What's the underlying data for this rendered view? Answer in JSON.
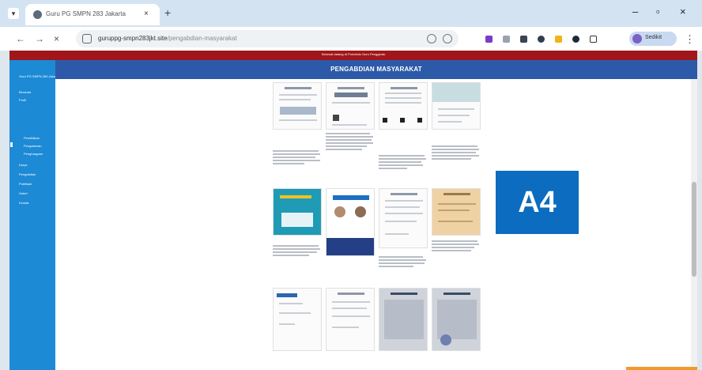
{
  "browser": {
    "tab_title": "Guru PG SMPN 283 Jakarta",
    "tab_menu_icon": "chevron-down-icon",
    "new_tab_label": "+",
    "url_host": "guruppg-smpn283jkt.site",
    "url_path": "/pengabdian-masyarakat",
    "profile_label": "Sedikit",
    "window_controls": [
      "–",
      "▫",
      "×"
    ]
  },
  "page": {
    "top_notice": "Selamat datang di Portofolio Guru Penggerak",
    "title": "PENGABDIAN MASYARAKAT",
    "sidebar_items": [
      {
        "label": "Guru PG SMPN 283 Jakarta",
        "sub": false
      },
      {
        "label": "Beranda",
        "sub": false
      },
      {
        "label": "Profil",
        "sub": false
      },
      {
        "label": "Pendidikan",
        "sub": true
      },
      {
        "label": "Pengalaman",
        "sub": true
      },
      {
        "label": "Penghargaan",
        "sub": true
      },
      {
        "label": "Karya",
        "sub": false
      },
      {
        "label": "Pengabdian",
        "sub": false
      },
      {
        "label": "Publikasi",
        "sub": false
      },
      {
        "label": "Galeri",
        "sub": false
      },
      {
        "label": "Kontak",
        "sub": false
      }
    ]
  },
  "overlay": {
    "badge_label": "A4",
    "badge_color": "#0b6cc0"
  },
  "colors": {
    "accent_red": "#a0161a",
    "sidebar_blue": "#1d8ad6",
    "title_blue": "#2d5aa8"
  }
}
